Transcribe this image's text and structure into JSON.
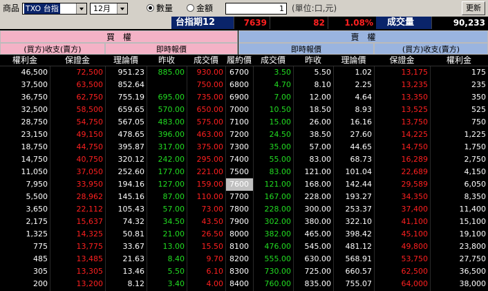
{
  "toolbar": {
    "product_label": "商品",
    "product_value": "TXO 台指",
    "month_value": "12月",
    "radio_qty_label": "數量",
    "radio_amt_label": "金額",
    "qty_value": "1",
    "unit_label": "(單位:口,元)",
    "refresh_label": "更新"
  },
  "quote": {
    "name": "台指期12",
    "price": "7639",
    "change": "82",
    "pct": "1.08%",
    "volume_label": "成交量",
    "volume": "90,233"
  },
  "headers": {
    "call": "買　權",
    "put": "賣　權",
    "call_margin": "(買方)收支(賣方)",
    "call_quote": "即時報價",
    "put_quote": "即時報價",
    "put_margin": "(買方)收支(賣方)",
    "columns": [
      "權利金",
      "保證金",
      "理論價",
      "昨收",
      "成交價",
      "履約價",
      "成交價",
      "昨收",
      "理論價",
      "保證金",
      "權利金"
    ]
  },
  "colors": {
    "white": "#ffffff",
    "red": "#ff2020",
    "green": "#22dd22",
    "call_header": "#f4b2c6",
    "put_header": "#9ab4df"
  },
  "rows": [
    [
      "46,500",
      "72,500",
      "951.23",
      "885.00",
      "930.00",
      "6700",
      "3.50",
      "5.50",
      "1.02",
      "13,175",
      "175"
    ],
    [
      "37,500",
      "63,500",
      "852.64",
      "",
      "750.00",
      "6800",
      "4.70",
      "8.10",
      "2.25",
      "13,235",
      "235"
    ],
    [
      "36,750",
      "62,750",
      "755.19",
      "695.00",
      "735.00",
      "6900",
      "7.00",
      "12.00",
      "4.64",
      "13,350",
      "350"
    ],
    [
      "32,500",
      "58,500",
      "659.65",
      "570.00",
      "650.00",
      "7000",
      "10.50",
      "18.50",
      "8.93",
      "13,525",
      "525"
    ],
    [
      "28,750",
      "54,750",
      "567.05",
      "483.00",
      "575.00",
      "7100",
      "15.00",
      "26.00",
      "16.16",
      "13,750",
      "750"
    ],
    [
      "23,150",
      "49,150",
      "478.65",
      "396.00",
      "463.00",
      "7200",
      "24.50",
      "38.50",
      "27.60",
      "14,225",
      "1,225"
    ],
    [
      "18,750",
      "44,750",
      "395.87",
      "317.00",
      "375.00",
      "7300",
      "35.00",
      "57.00",
      "44.65",
      "14,750",
      "1,750"
    ],
    [
      "14,750",
      "40,750",
      "320.12",
      "242.00",
      "295.00",
      "7400",
      "55.00",
      "83.00",
      "68.73",
      "16,289",
      "2,750"
    ],
    [
      "11,050",
      "37,050",
      "252.60",
      "177.00",
      "221.00",
      "7500",
      "83.00",
      "121.00",
      "101.04",
      "22,689",
      "4,150"
    ],
    [
      "7,950",
      "33,950",
      "194.16",
      "127.00",
      "159.00",
      "7600",
      "121.00",
      "168.00",
      "142.44",
      "29,589",
      "6,050"
    ],
    [
      "5,500",
      "28,962",
      "145.16",
      "87.00",
      "110.00",
      "7700",
      "167.00",
      "228.00",
      "193.27",
      "34,350",
      "8,350"
    ],
    [
      "3,650",
      "22,112",
      "105.43",
      "57.00",
      "73.00",
      "7800",
      "228.00",
      "300.00",
      "253.37",
      "37,400",
      "11,400"
    ],
    [
      "2,175",
      "15,637",
      "74.32",
      "34.50",
      "43.50",
      "7900",
      "302.00",
      "380.00",
      "322.10",
      "41,100",
      "15,100"
    ],
    [
      "1,325",
      "14,325",
      "50.81",
      "21.00",
      "26.50",
      "8000",
      "382.00",
      "465.00",
      "398.42",
      "45,100",
      "19,100"
    ],
    [
      "775",
      "13,775",
      "33.67",
      "13.00",
      "15.50",
      "8100",
      "476.00",
      "545.00",
      "481.12",
      "49,800",
      "23,800"
    ],
    [
      "485",
      "13,485",
      "21.63",
      "8.40",
      "9.70",
      "8200",
      "555.00",
      "630.00",
      "568.91",
      "53,750",
      "27,750"
    ],
    [
      "305",
      "13,305",
      "13.46",
      "5.50",
      "6.10",
      "8300",
      "730.00",
      "725.00",
      "660.57",
      "62,500",
      "36,500"
    ],
    [
      "200",
      "13,200",
      "8.12",
      "3.40",
      "4.00",
      "8400",
      "760.00",
      "835.00",
      "755.07",
      "64,000",
      "38,000"
    ]
  ]
}
